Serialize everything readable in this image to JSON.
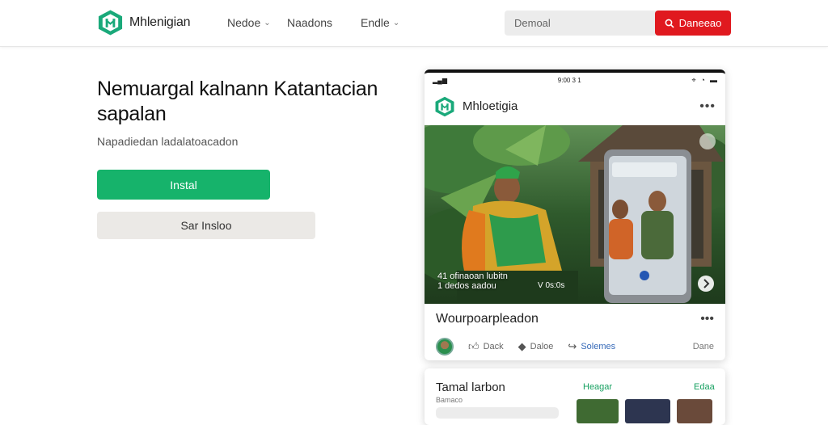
{
  "header": {
    "logo_text": "Mhlenigian",
    "nav": [
      {
        "label": "Nedoe",
        "has_dropdown": true
      },
      {
        "label": "Naadons",
        "has_dropdown": false
      },
      {
        "label": "Endle",
        "has_dropdown": true
      }
    ],
    "search_placeholder": "Demoal",
    "cta_label": "Daneeao",
    "cta_icon": "search-icon"
  },
  "hero": {
    "title": "Nemuargal kalnann Katantacian sapalan",
    "subtitle": "Napadiedan ladalatoacadon",
    "primary_button": "Instal",
    "secondary_button": "Sar Insloo"
  },
  "phone": {
    "status_time": "9:00 3 1",
    "app_name": "Mhloetigia",
    "photo_caption_line1": "41 ofinaoan lubitn",
    "photo_caption_line2": "1 dedos aadou",
    "photo_caption_extra": "V 0s:0s",
    "post_title": "Wourpoarpleadon",
    "actions": [
      {
        "icon": "thumbs-up-icon",
        "label": "Dack"
      },
      {
        "icon": "pin-icon",
        "label": "Daloe"
      },
      {
        "icon": "share-icon",
        "label": "Solemes"
      }
    ],
    "actions_right": "Dane"
  },
  "card2": {
    "title": "Tamal larbon",
    "subtitle": "Bamaco",
    "mid_label": "Heagar",
    "right_label": "Edaa"
  },
  "colors": {
    "brand_green": "#16b36b",
    "cta_red": "#e0191f",
    "link_blue": "#3569b8"
  }
}
